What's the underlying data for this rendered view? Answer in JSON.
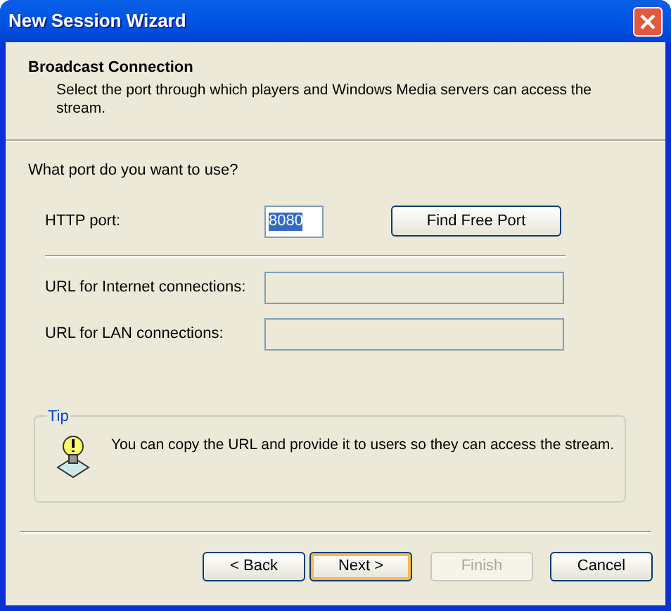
{
  "window": {
    "title": "New Session Wizard"
  },
  "header": {
    "title": "Broadcast Connection",
    "subtitle": "Select the port through which players and Windows Media servers can access the stream."
  },
  "question": "What port do you want to use?",
  "http_port": {
    "label": "HTTP port:",
    "value": "8080",
    "selected": true
  },
  "find_button": {
    "label": "Find Free Port"
  },
  "url_fields": [
    {
      "label": "URL for Internet connections:",
      "disabled": true
    },
    {
      "label": "URL for LAN connections:",
      "disabled": true
    }
  ],
  "tip": {
    "legend": "Tip",
    "text": "You can copy the URL and provide it to users so they can access the stream."
  },
  "buttons": [
    {
      "label": "< Back",
      "disabled": false,
      "default": false
    },
    {
      "label": "Next >",
      "disabled": false,
      "default": true
    },
    {
      "label": "Finish",
      "disabled": true,
      "default": false
    },
    {
      "label": "Cancel",
      "disabled": false,
      "default": false
    }
  ]
}
